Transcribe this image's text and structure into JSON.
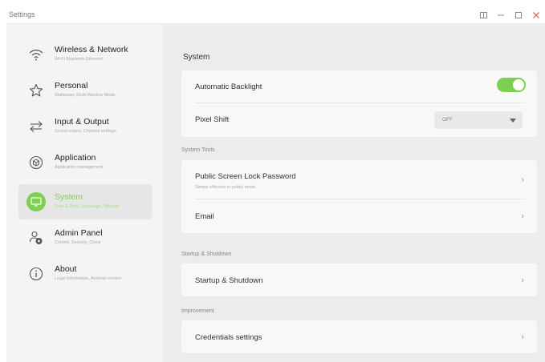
{
  "window": {
    "title": "Settings",
    "controls": [
      "restore-icon",
      "minimize-icon",
      "maximize-icon",
      "close-icon"
    ]
  },
  "colors": {
    "accent": "#7dcf52",
    "close": "#e25b5b"
  },
  "sidebar": {
    "items": [
      {
        "label": "Wireless & Network",
        "sub": "Wi-Fi Bluetooth Ethernet",
        "icon": "wifi-icon",
        "active": false
      },
      {
        "label": "Personal",
        "sub": "Wallpaper, Multi-Window Mode",
        "icon": "star-icon",
        "active": false
      },
      {
        "label": "Input & Output",
        "sub": "Sound output, Channel settings",
        "icon": "arrows-icon",
        "active": false
      },
      {
        "label": "Application",
        "sub": "Application management",
        "icon": "cube-icon",
        "active": false
      },
      {
        "label": "System",
        "sub": "Date & Time, Language, Storage",
        "icon": "monitor-icon",
        "active": true
      },
      {
        "label": "Admin Panel",
        "sub": "Control, Security, Clone",
        "icon": "admin-icon",
        "active": false
      },
      {
        "label": "About",
        "sub": "Legal information, Android version",
        "icon": "info-icon",
        "active": false
      }
    ]
  },
  "main": {
    "heading": "System",
    "system": {
      "backlight_label": "Automatic Backlight",
      "backlight_on": true,
      "pixel_shift_label": "Pixel Shift",
      "pixel_shift_value": "OFF"
    },
    "tools": {
      "group_label": "System Tools",
      "lock_label": "Public Screen Lock Password",
      "lock_sub": "Simply effective in public mode",
      "email_label": "Email"
    },
    "startup": {
      "group_label": "Startup & Shutdown",
      "item_label": "Startup & Shutdown"
    },
    "improvement": {
      "group_label": "Improvement",
      "credentials_label": "Credentials settings"
    }
  }
}
